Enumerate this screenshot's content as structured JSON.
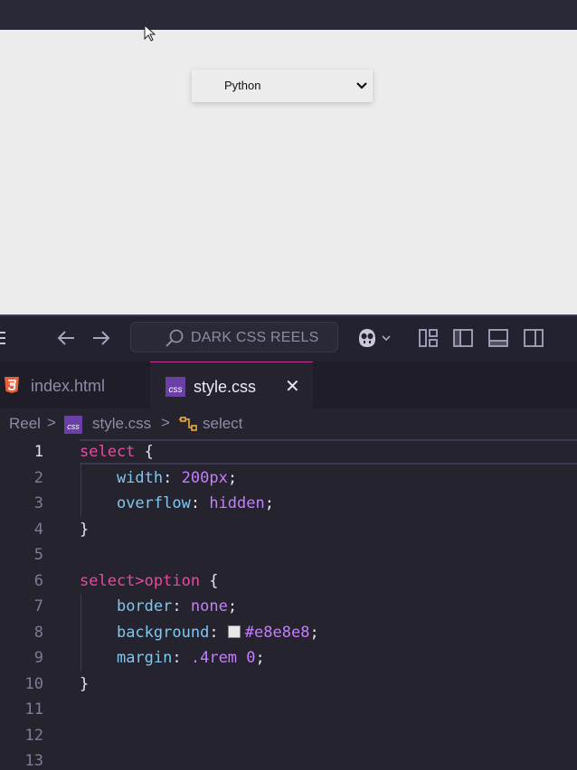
{
  "preview": {
    "select_value": "Python"
  },
  "titlebar": {
    "search_label": "DARK CSS REELS"
  },
  "tabs": [
    {
      "label": "index.html",
      "icon": "html5-icon"
    },
    {
      "label": "style.css",
      "icon": "css-icon",
      "close_glyph": "✕"
    }
  ],
  "breadcrumb": {
    "folder": "Reel",
    "file": "style.css",
    "symbol": "select",
    "separator": ">"
  },
  "editor": {
    "line_numbers": [
      "1",
      "2",
      "3",
      "4",
      "5",
      "6",
      "7",
      "8",
      "9",
      "10",
      "11",
      "12",
      "13"
    ],
    "lines": [
      {
        "sel": "select",
        "brace": " {"
      },
      {
        "prop": "width",
        "colon": ": ",
        "val": "200px",
        "end": ";"
      },
      {
        "prop": "overflow",
        "colon": ": ",
        "val": "hidden",
        "end": ";"
      },
      {
        "brace": "}"
      },
      {},
      {
        "sel": "select>option",
        "brace": " {"
      },
      {
        "prop": "border",
        "colon": ": ",
        "val": "none",
        "end": ";"
      },
      {
        "prop": "background",
        "colon": ": ",
        "val": "#e8e8e8",
        "end": ";"
      },
      {
        "prop": "margin",
        "colon": ": ",
        "val": ".4rem 0",
        "end": ";"
      },
      {
        "brace": "}"
      }
    ]
  },
  "colors": {
    "accent": "#c4358f",
    "selector": "#e94aa0",
    "property": "#7ec8f2",
    "value": "#c77dff",
    "swatch": "#e8e8e8"
  }
}
